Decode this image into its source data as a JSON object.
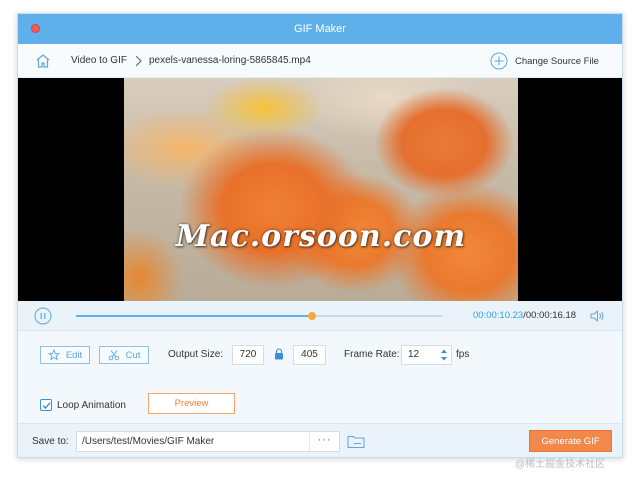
{
  "window": {
    "title": "GIF Maker"
  },
  "breadcrumb": {
    "items": [
      "Video to GIF",
      "pexels-vanessa-loring-5865845.mp4"
    ],
    "change_source_label": "Change Source File"
  },
  "video": {
    "watermark": "Mac.orsoon.com"
  },
  "playback": {
    "progress": 0.645,
    "current_time": "00:00:10.23",
    "total_time": "/00:00:16.18"
  },
  "controls": {
    "edit_label": "Edit",
    "cut_label": "Cut",
    "output_size_label": "Output Size:",
    "width": "720",
    "height": "405",
    "frame_rate_label": "Frame Rate:",
    "frame_rate": "12",
    "fps_label": "fps",
    "loop_label": "Loop Animation",
    "loop_checked": true,
    "preview_label": "Preview"
  },
  "save": {
    "label": "Save to:",
    "path": "/Users/test/Movies/GIF Maker",
    "more": "···",
    "generate_label": "Generate GIF"
  },
  "footer": {
    "mark": "@稀土掘金技术社区"
  },
  "colors": {
    "accent": "#5fb0ea",
    "orange": "#f3884b",
    "time_current": "#3b9ee4"
  },
  "icons": [
    "close-icon",
    "home-icon",
    "chevron-right-icon",
    "plus-circle-icon",
    "pause-icon",
    "volume-icon",
    "edit-star-icon",
    "scissors-icon",
    "lock-icon",
    "spinner-arrows-icon",
    "checkmark-icon",
    "folder-icon"
  ]
}
